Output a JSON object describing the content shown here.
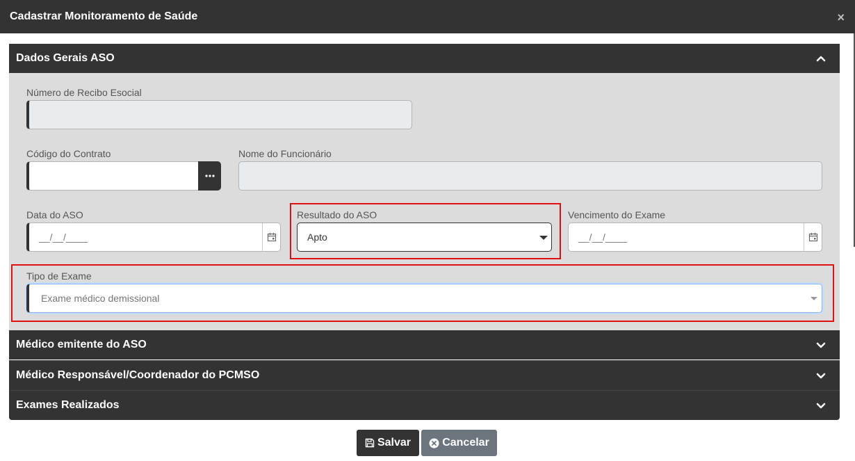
{
  "modal": {
    "title": "Cadastrar Monitoramento de Saúde",
    "close_symbol": "×"
  },
  "sections": {
    "dados_gerais": {
      "title": "Dados Gerais ASO"
    },
    "medico_emitente": {
      "title": "Médico emitente do ASO"
    },
    "medico_responsavel": {
      "title": "Médico Responsável/Coordenador do PCMSO"
    },
    "exames_realizados": {
      "title": "Exames Realizados"
    }
  },
  "form": {
    "numero_recibo": {
      "label": "Número de Recibo Esocial",
      "value": ""
    },
    "codigo_contrato": {
      "label": "Código do Contrato",
      "value": ""
    },
    "nome_funcionario": {
      "label": "Nome do Funcionário",
      "value": ""
    },
    "data_aso": {
      "label": "Data do ASO",
      "value": "__/__/____"
    },
    "resultado_aso": {
      "label": "Resultado do ASO",
      "value": "Apto"
    },
    "vencimento_exame": {
      "label": "Vencimento do Exame",
      "value": "__/__/____"
    },
    "tipo_exame": {
      "label": "Tipo de Exame",
      "value": "Exame médico demissional"
    }
  },
  "footer": {
    "save_label": "Salvar",
    "cancel_label": "Cancelar"
  },
  "colors": {
    "header_bg": "#333333",
    "body_bg": "#dcdcdc",
    "highlight": "#e01010",
    "cancel_bg": "#6c757d"
  }
}
